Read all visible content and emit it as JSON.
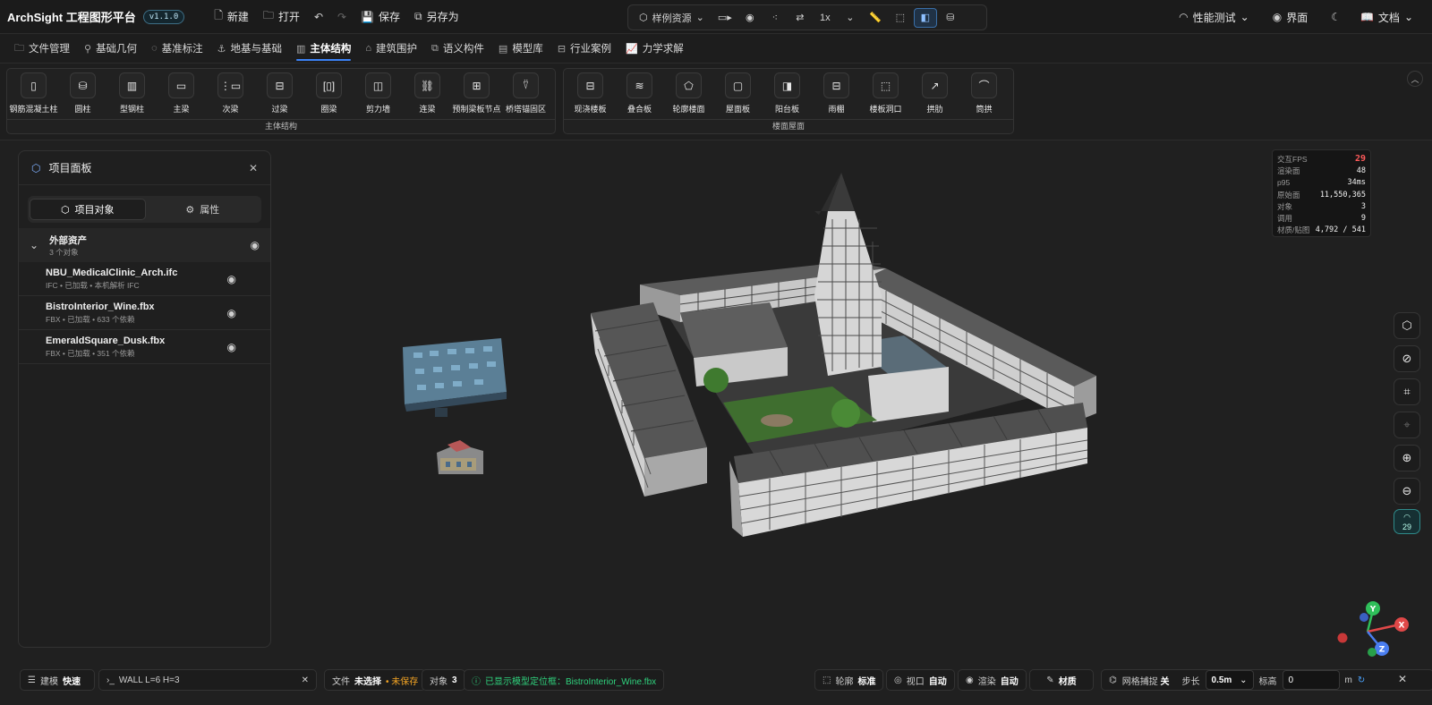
{
  "app": {
    "title": "ArchSight 工程图形平台",
    "version": "v1.1.0"
  },
  "top_actions": [
    {
      "icon": "new-file-icon",
      "glyph": "🗋",
      "label": "新建"
    },
    {
      "icon": "folder-open-icon",
      "glyph": "🗀",
      "label": "打开"
    }
  ],
  "save_actions": [
    {
      "icon": "save-icon",
      "glyph": "💾",
      "label": "保存"
    },
    {
      "icon": "save-as-icon",
      "glyph": "⧉",
      "label": "另存为"
    }
  ],
  "center_tools": {
    "sample_assets": "样例资源",
    "speed": "1x"
  },
  "right_tools": {
    "perf": "性能测试",
    "ui": "界面",
    "docs": "文档"
  },
  "tabs": [
    {
      "label": "文件管理",
      "glyph": "🗀"
    },
    {
      "label": "基础几何",
      "glyph": "⚲"
    },
    {
      "label": "基准标注",
      "glyph": "◌"
    },
    {
      "label": "地基与基础",
      "glyph": "⚓"
    },
    {
      "label": "主体结构",
      "glyph": "▥",
      "active": true
    },
    {
      "label": "建筑围护",
      "glyph": "⌂"
    },
    {
      "label": "语义构件",
      "glyph": "⧉"
    },
    {
      "label": "模型库",
      "glyph": "▤"
    },
    {
      "label": "行业案例",
      "glyph": "⊟"
    },
    {
      "label": "力学求解",
      "glyph": "📈"
    }
  ],
  "ribbon": {
    "groups": [
      {
        "title": "主体结构",
        "items": [
          {
            "label": "钢筋混凝土柱",
            "glyph": "▯",
            "icon": "column-icon"
          },
          {
            "label": "圆柱",
            "glyph": "⛁",
            "icon": "cylinder-icon"
          },
          {
            "label": "型钢柱",
            "glyph": "▥",
            "icon": "steel-column-icon"
          },
          {
            "label": "主梁",
            "glyph": "▭",
            "icon": "main-beam-icon"
          },
          {
            "label": "次梁",
            "glyph": "⋮▭",
            "icon": "secondary-beam-icon"
          },
          {
            "label": "过梁",
            "glyph": "⊟",
            "icon": "lintel-icon"
          },
          {
            "label": "圈梁",
            "glyph": "[▯]",
            "icon": "ring-beam-icon"
          },
          {
            "label": "剪力墙",
            "glyph": "◫",
            "icon": "shear-wall-icon"
          },
          {
            "label": "连梁",
            "glyph": "⛓",
            "icon": "link-icon"
          },
          {
            "label": "预制梁板节点",
            "glyph": "⊞",
            "icon": "precast-node-icon"
          },
          {
            "label": "桥塔锚固区",
            "glyph": "⍢",
            "icon": "tower-anchor-icon"
          }
        ]
      },
      {
        "title": "楼面屋面",
        "items": [
          {
            "label": "现浇楼板",
            "glyph": "⊟",
            "icon": "cast-slab-icon"
          },
          {
            "label": "叠合板",
            "glyph": "≋",
            "icon": "layers-icon"
          },
          {
            "label": "轮廓楼面",
            "glyph": "⬠",
            "icon": "pentagon-icon"
          },
          {
            "label": "屋面板",
            "glyph": "▢",
            "icon": "roof-panel-icon"
          },
          {
            "label": "阳台板",
            "glyph": "◨",
            "icon": "balcony-icon"
          },
          {
            "label": "雨棚",
            "glyph": "⊟",
            "icon": "canopy-icon"
          },
          {
            "label": "楼板洞口",
            "glyph": "⬚",
            "icon": "slab-opening-icon"
          },
          {
            "label": "拱肋",
            "glyph": "↗",
            "icon": "arch-rib-icon"
          },
          {
            "label": "筒拱",
            "glyph": "⌒",
            "icon": "barrel-arch-icon"
          }
        ]
      }
    ]
  },
  "panel": {
    "title": "项目面板",
    "seg_objects": "项目对象",
    "seg_props": "属性",
    "group": {
      "name": "外部资产",
      "count": "3 个对象"
    },
    "items": [
      {
        "name": "NBU_MedicalClinic_Arch.ifc",
        "meta": "IFC • 已加载 • 本机解析 IFC"
      },
      {
        "name": "BistroInterior_Wine.fbx",
        "meta": "FBX • 已加载 • 633 个依赖"
      },
      {
        "name": "EmeraldSquare_Dusk.fbx",
        "meta": "FBX • 已加载 • 351 个依赖"
      }
    ]
  },
  "fps_panel": [
    {
      "k": "交互FPS",
      "v": "29",
      "red": true
    },
    {
      "k": "渲染面",
      "v": "48"
    },
    {
      "k": "p95",
      "v": "34ms"
    },
    {
      "k": "原始面",
      "v": "11,550,365"
    },
    {
      "k": "对象",
      "v": "3"
    },
    {
      "k": "调用",
      "v": "9"
    },
    {
      "k": "材质/贴图",
      "v": "4,792 / 541"
    }
  ],
  "fps_badge": "29",
  "axis": {
    "x": "X",
    "y": "Y",
    "z": "Z"
  },
  "status": {
    "mode_label": "建模",
    "mode_value": "快速",
    "command": "WALL L=6 H=3",
    "file_label": "文件",
    "file_value": "未选择",
    "file_state": "• 未保存",
    "obj_label": "对象",
    "obj_value": "3",
    "message": "已显示模型定位框：BistroInterior_Wine.fbx",
    "outline_label": "轮廓",
    "outline_value": "标准",
    "view_label": "视口",
    "view_value": "自动",
    "render_label": "渲染",
    "render_value": "自动",
    "material_label": "材质",
    "snap_label": "网格捕捉",
    "snap_value": "关",
    "step_label": "步长",
    "step_value": "0.5m",
    "elev_label": "标高",
    "elev_value": "0",
    "elev_unit": "m"
  }
}
